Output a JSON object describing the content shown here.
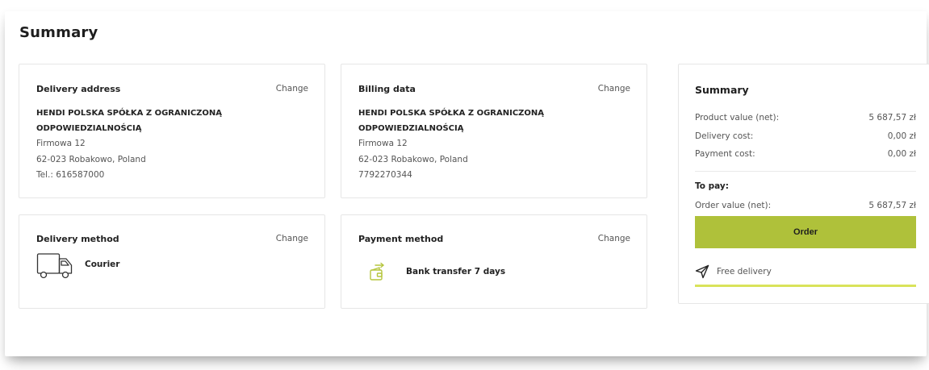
{
  "page": {
    "title": "Summary"
  },
  "delivery_address": {
    "title": "Delivery address",
    "change_label": "Change",
    "company_line1": "HENDI POLSKA SPÓŁKA Z OGRANICZONĄ",
    "company_line2": "ODPOWIEDZIALNOŚCIĄ",
    "street": "Firmowa 12",
    "city": "62-023 Robakowo, Poland",
    "phone": "Tel.: 616587000"
  },
  "billing_data": {
    "title": "Billing data",
    "change_label": "Change",
    "company_line1": "HENDI POLSKA SPÓŁKA Z OGRANICZONĄ",
    "company_line2": "ODPOWIEDZIALNOŚCIĄ",
    "street": "Firmowa 12",
    "city": "62-023 Robakowo, Poland",
    "tax_id": "7792270344"
  },
  "delivery_method": {
    "title": "Delivery method",
    "change_label": "Change",
    "option": "Courier",
    "icon": "truck-icon"
  },
  "payment_method": {
    "title": "Payment method",
    "change_label": "Change",
    "option": "Bank transfer 7 days",
    "icon": "wallet-transfer-icon"
  },
  "summary": {
    "title": "Summary",
    "product_value_label": "Product value (net):",
    "product_value": "5 687,57 zł",
    "delivery_cost_label": "Delivery cost:",
    "delivery_cost": "0,00 zł",
    "payment_cost_label": "Payment cost:",
    "payment_cost": "0,00 zł",
    "to_pay_label": "To pay:",
    "order_value_label": "Order value (net):",
    "order_value": "5 687,57 zł",
    "order_button": "Order",
    "free_delivery_label": "Free delivery",
    "free_delivery_progress": 1.0
  },
  "colors": {
    "accent": "#afc13a",
    "progress": "#d9e35a",
    "icon_green": "#b5c53d"
  }
}
